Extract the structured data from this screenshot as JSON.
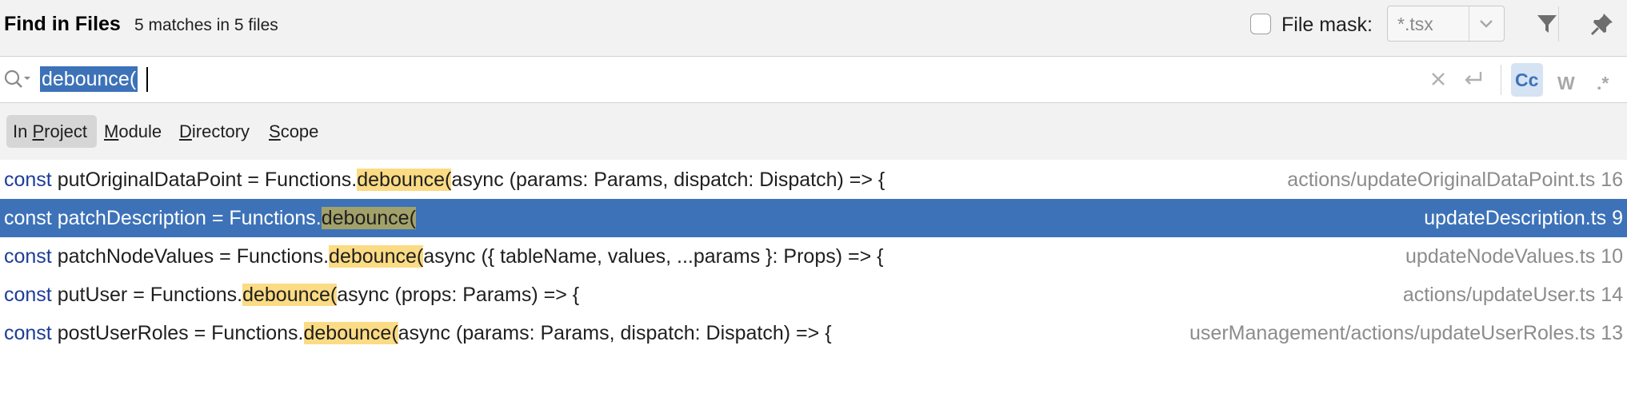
{
  "header": {
    "title": "Find in Files",
    "match_count": "5 matches in 5 files",
    "file_mask_label": "File mask:",
    "file_mask_value": "*.tsx",
    "file_mask_checked": false,
    "icons": [
      "filter-icon",
      "pin-icon"
    ]
  },
  "search": {
    "query": "debounce(",
    "options": {
      "match_case": "Cc",
      "words": "W",
      "regex": ".*"
    },
    "match_case_active": true,
    "icons": [
      "search-history-icon",
      "clear-icon",
      "newline-icon"
    ]
  },
  "scope": {
    "tabs": [
      {
        "pre": "In ",
        "mnemonic": "P",
        "post": "roject",
        "active": true
      },
      {
        "pre": "",
        "mnemonic": "M",
        "post": "odule",
        "active": false
      },
      {
        "pre": "",
        "mnemonic": "D",
        "post": "irectory",
        "active": false
      },
      {
        "pre": "",
        "mnemonic": "S",
        "post": "cope",
        "active": false
      }
    ]
  },
  "results": [
    {
      "kw": "const",
      "before": " putOriginalDataPoint = Functions.",
      "match": "debounce(",
      "after": "async (params: Params, dispatch: Dispatch) => {",
      "file": "actions/updateOriginalDataPoint.ts 16",
      "selected": false
    },
    {
      "kw": "const",
      "before": " patchDescription = Functions.",
      "match": "debounce(",
      "after": "",
      "file": "updateDescription.ts 9",
      "selected": true
    },
    {
      "kw": "const",
      "before": " patchNodeValues = Functions.",
      "match": "debounce(",
      "after": "async ({ tableName, values, ...params }: Props) => {",
      "file": "updateNodeValues.ts 10",
      "selected": false
    },
    {
      "kw": "const",
      "before": " putUser = Functions.",
      "match": "debounce(",
      "after": "async (props: Params) => {",
      "file": "actions/updateUser.ts 14",
      "selected": false
    },
    {
      "kw": "const",
      "before": " postUserRoles = Functions.",
      "match": "debounce(",
      "after": "async (params: Params, dispatch: Dispatch) => {",
      "file": "userManagement/actions/updateUserRoles.ts 13",
      "selected": false
    }
  ],
  "colors": {
    "selection": "#3d72b8",
    "match_highlight": "#fbdb83",
    "keyword": "#1d3c9b"
  }
}
